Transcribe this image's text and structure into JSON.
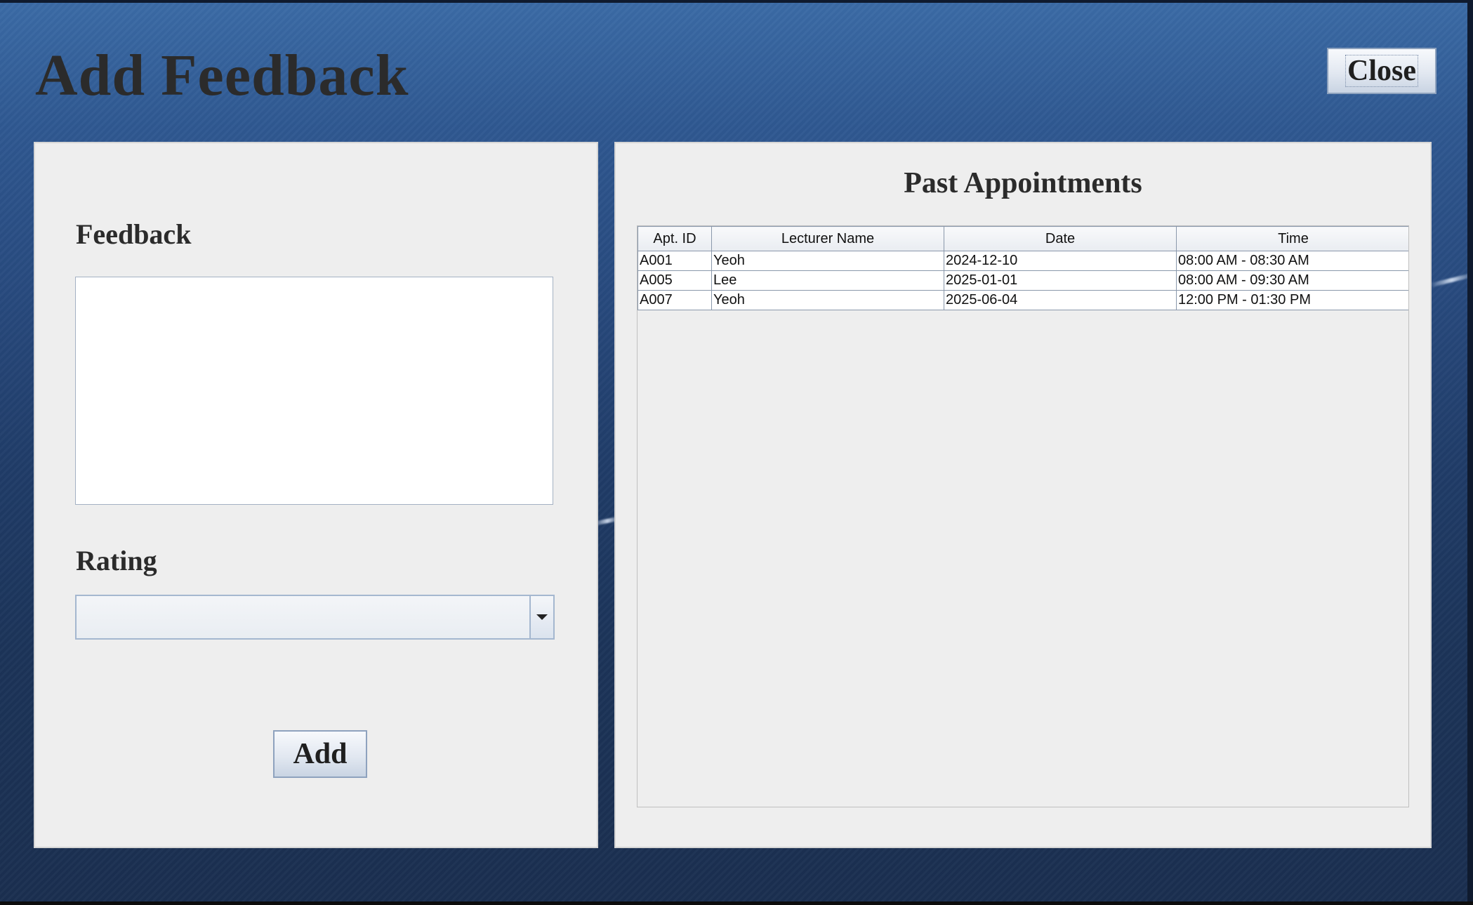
{
  "window": {
    "title": "Add Feedback",
    "close_label": "Close"
  },
  "feedback_panel": {
    "feedback_label": "Feedback",
    "feedback_value": "",
    "rating_label": "Rating",
    "rating_value": "",
    "add_label": "Add"
  },
  "appointments_panel": {
    "title": "Past Appointments",
    "columns": [
      "Apt. ID",
      "Lecturer Name",
      "Date",
      "Time"
    ],
    "rows": [
      [
        "A001",
        "Yeoh",
        "2024-12-10",
        "08:00 AM - 08:30 AM"
      ],
      [
        "A005",
        "Lee",
        "2025-01-01",
        "08:00 AM - 09:30 AM"
      ],
      [
        "A007",
        "Yeoh",
        "2025-06-04",
        "12:00 PM - 01:30 PM"
      ]
    ]
  },
  "colors": {
    "background_top": "#3b6ba6",
    "background_bottom": "#1b2f50",
    "panel": "#eeeeee",
    "button_border": "#8ea2be"
  }
}
